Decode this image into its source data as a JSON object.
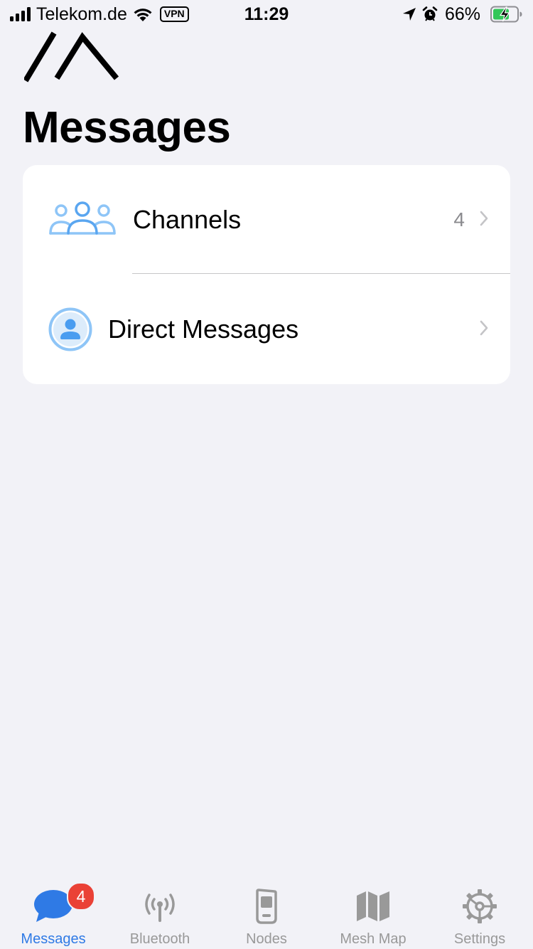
{
  "status_bar": {
    "carrier": "Telekom.de",
    "vpn": "VPN",
    "time": "11:29",
    "battery_percent": "66%",
    "battery_level": 0.66,
    "icons": [
      "signal-icon",
      "wifi-icon",
      "location-arrow-icon",
      "alarm-icon",
      "battery-charging-icon"
    ]
  },
  "header": {
    "logo": "meshtastic-logo",
    "title": "Messages"
  },
  "list": {
    "items": [
      {
        "label": "Channels",
        "count": "4",
        "icon": "channels-group-icon"
      },
      {
        "label": "Direct Messages",
        "count": "",
        "icon": "person-circle-icon"
      }
    ]
  },
  "tab_bar": {
    "tabs": [
      {
        "label": "Messages",
        "icon": "chat-bubble-icon",
        "active": true,
        "badge": "4"
      },
      {
        "label": "Bluetooth",
        "icon": "antenna-icon",
        "active": false
      },
      {
        "label": "Nodes",
        "icon": "radio-device-icon",
        "active": false
      },
      {
        "label": "Mesh Map",
        "icon": "map-icon",
        "active": false
      },
      {
        "label": "Settings",
        "icon": "gear-icon",
        "active": false
      }
    ]
  },
  "colors": {
    "background": "#f2f2f7",
    "card": "#ffffff",
    "accent": "#2f7ae5",
    "icon_blue": "#8ec5f7",
    "inactive": "#999999",
    "badge": "#ea4136"
  }
}
